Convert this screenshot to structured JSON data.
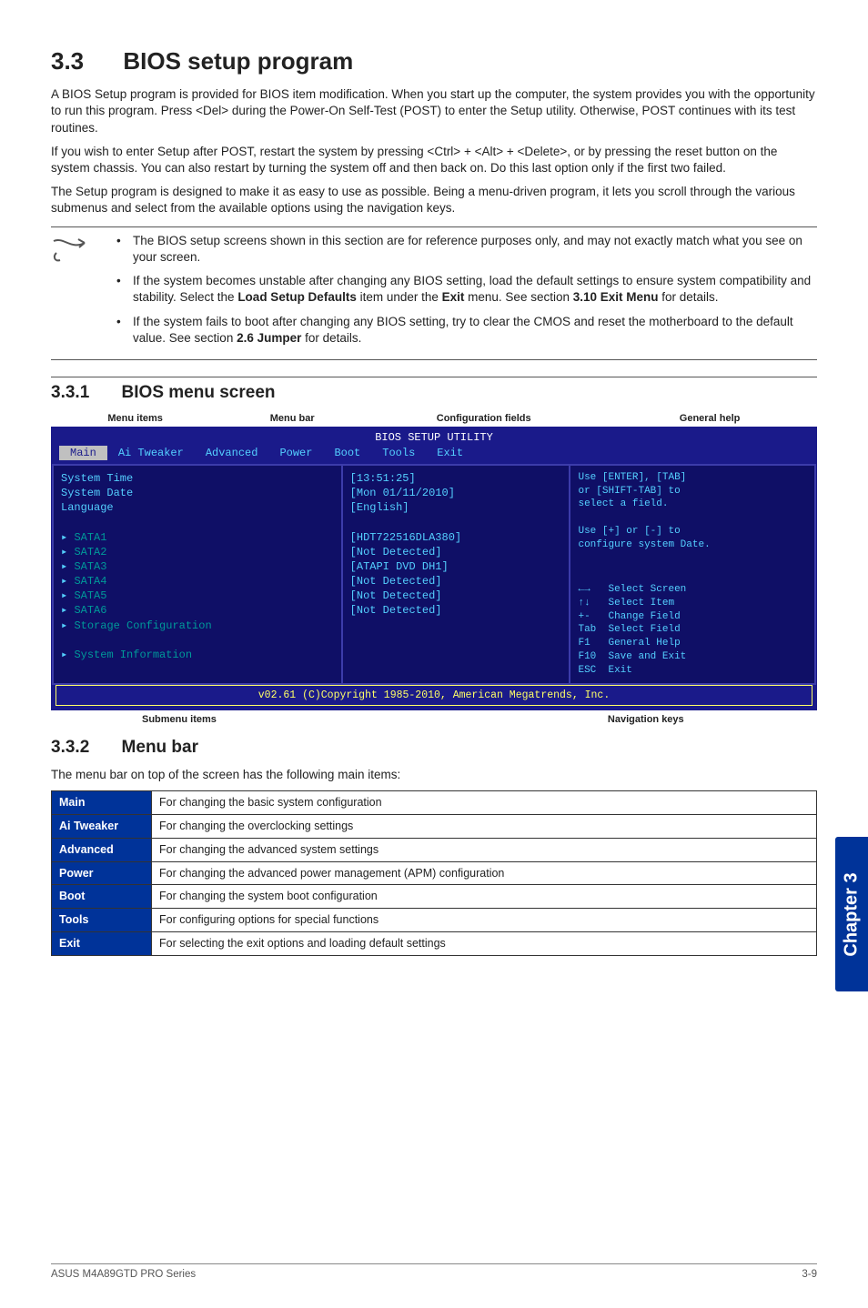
{
  "h1_num": "3.3",
  "h1_title": "BIOS setup program",
  "para1": "A BIOS Setup program is provided for BIOS item modification. When you start up the computer, the system provides you with the opportunity to run this program. Press <Del> during the Power-On Self-Test (POST) to enter the Setup utility. Otherwise, POST continues with its test routines.",
  "para2": "If you wish to enter Setup after POST, restart the system by pressing <Ctrl> + <Alt> + <Delete>, or by pressing the reset button on the system chassis. You can also restart by turning the system off and then back on. Do this last option only if the first two failed.",
  "para3": "The Setup program is designed to make it as easy to use as possible. Being a menu-driven program, it lets you scroll through the various submenus and select from the available options using the navigation keys.",
  "notes": {
    "n1": "The BIOS setup screens shown in this section are for reference purposes only, and may not exactly match what you see on your screen.",
    "n2_a": "If the system becomes unstable after changing any BIOS setting, load the default settings to ensure system compatibility and stability. Select the ",
    "n2_b": "Load Setup Defaults",
    "n2_c": " item under the ",
    "n2_d": "Exit",
    "n2_e": " menu. See section ",
    "n2_f": "3.10 Exit Menu",
    "n2_g": " for details.",
    "n3_a": "If the system fails to boot after changing any BIOS setting, try to clear the CMOS and reset the motherboard to the default value. ",
    "n3_b": "See section ",
    "n3_c": "2.6 Jumper",
    "n3_d": " for details."
  },
  "h2a_num": "3.3.1",
  "h2a_title": "BIOS menu screen",
  "bios_labels_top": {
    "a": "Menu items",
    "b": "Menu bar",
    "c": "Configuration fields",
    "d": "General help"
  },
  "bios": {
    "title": "BIOS SETUP UTILITY",
    "tabs": {
      "main": "Main",
      "ai": "Ai Tweaker",
      "adv": "Advanced",
      "pow": "Power",
      "boot": "Boot",
      "tools": "Tools",
      "exit": "Exit"
    },
    "left": {
      "systime": "System Time",
      "sysdate": "System Date",
      "lang": "Language",
      "sata1": "SATA1",
      "sata2": "SATA2",
      "sata3": "SATA3",
      "sata4": "SATA4",
      "sata5": "SATA5",
      "sata6": "SATA6",
      "storage": "Storage Configuration",
      "sysinfo": "System Information"
    },
    "mid": {
      "time": "[13:51:25]",
      "date": "[Mon 01/11/2010]",
      "lang": "[English]",
      "v1": "[HDT722516DLA380]",
      "v2": "[Not Detected]",
      "v3": "[ATAPI DVD DH1]",
      "v4": "[Not Detected]",
      "v5": "[Not Detected]",
      "v6": "[Not Detected]"
    },
    "right": {
      "help1": "Use [ENTER], [TAB]",
      "help2": "or [SHIFT-TAB] to",
      "help3": "select a field.",
      "help4": "Use [+] or [-] to",
      "help5": "configure system Date.",
      "k1": "←→   Select Screen",
      "k2": "↑↓   Select Item",
      "k3": "+-   Change Field",
      "k4": "Tab  Select Field",
      "k5": "F1   General Help",
      "k6": "F10  Save and Exit",
      "k7": "ESC  Exit"
    },
    "copy": "v02.61 (C)Copyright 1985-2010, American Megatrends, Inc."
  },
  "bios_labels_bottom": {
    "a": "Submenu items",
    "b": "Navigation keys"
  },
  "h2b_num": "3.3.2",
  "h2b_title": "Menu bar",
  "menubar_intro": "The menu bar on top of the screen has the following main items:",
  "menutable": {
    "r1a": "Main",
    "r1b": "For changing the basic system configuration",
    "r2a": "Ai Tweaker",
    "r2b": "For changing the overclocking settings",
    "r3a": "Advanced",
    "r3b": "For changing the advanced system settings",
    "r4a": "Power",
    "r4b": "For changing the advanced power management (APM) configuration",
    "r5a": "Boot",
    "r5b": "For changing the system boot configuration",
    "r6a": "Tools",
    "r6b": "For configuring options for special functions",
    "r7a": "Exit",
    "r7b": "For selecting the exit options and loading default settings"
  },
  "sidetab": "Chapter 3",
  "footer_left": "ASUS M4A89GTD PRO Series",
  "footer_right": "3-9"
}
